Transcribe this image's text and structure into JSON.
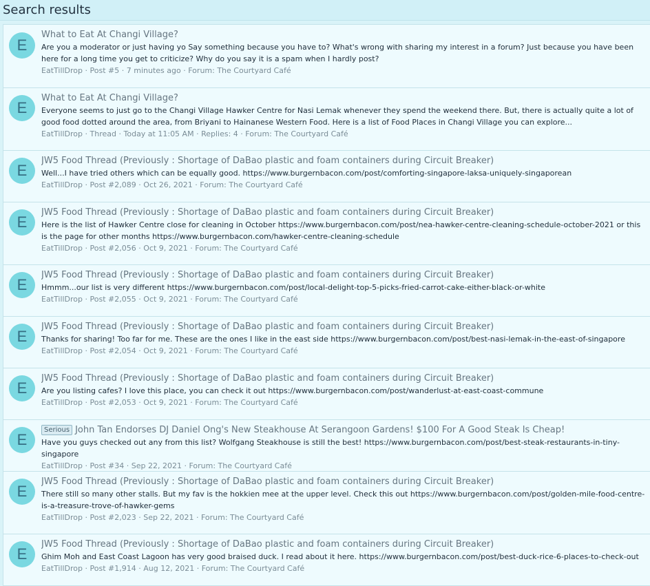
{
  "page": {
    "title": "Search results"
  },
  "results": [
    {
      "avatar_letter": "E",
      "badge": "",
      "title": "What to Eat At Changi Village?",
      "snippet": "Are you a moderator or just having yo Say something because you have to? What's wrong with sharing my interest in a forum? Just because you have been here for a long time you get to criticize? Why do you say it is a spam when I hardly post?",
      "meta": {
        "author": "EatTillDrop",
        "type": "Post #5",
        "time": "7 minutes ago",
        "forum": "Forum: The Courtyard Café"
      }
    },
    {
      "avatar_letter": "E",
      "badge": "",
      "title": "What to Eat At Changi Village?",
      "snippet": "Everyone seems to just go to the Changi Village Hawker Centre for Nasi Lemak whenever they spend the weekend there. But, there is actually quite a lot of good food dotted around the area, from Briyani to Hainanese Western Food. Here is a list of Food Places in Changi Village you can explore...",
      "meta": {
        "author": "EatTillDrop",
        "type": "Thread",
        "time": "Today at 11:05 AM",
        "replies": "Replies: 4",
        "forum": "Forum: The Courtyard Café"
      }
    },
    {
      "avatar_letter": "E",
      "badge": "",
      "title": "JW5 Food Thread (Previously : Shortage of DaBao plastic and foam containers during Circuit Breaker)",
      "snippet": "Well...I have tried others which can be equally good. https://www.burgernbacon.com/post/comforting-singapore-laksa-uniquely-singaporean",
      "meta": {
        "author": "EatTillDrop",
        "type": "Post #2,089",
        "time": "Oct 26, 2021",
        "forum": "Forum: The Courtyard Café"
      }
    },
    {
      "avatar_letter": "E",
      "badge": "",
      "title": "JW5 Food Thread (Previously : Shortage of DaBao plastic and foam containers during Circuit Breaker)",
      "snippet": "Here is the list of Hawker Centre close for cleaning in October https://www.burgernbacon.com/post/nea-hawker-centre-cleaning-schedule-october-2021 or this is the page for other months https://www.burgernbacon.com/hawker-centre-cleaning-schedule",
      "meta": {
        "author": "EatTillDrop",
        "type": "Post #2,056",
        "time": "Oct 9, 2021",
        "forum": "Forum: The Courtyard Café"
      }
    },
    {
      "avatar_letter": "E",
      "badge": "",
      "title": "JW5 Food Thread (Previously : Shortage of DaBao plastic and foam containers during Circuit Breaker)",
      "snippet": "Hmmm...our list is very different https://www.burgernbacon.com/post/local-delight-top-5-picks-fried-carrot-cake-either-black-or-white",
      "meta": {
        "author": "EatTillDrop",
        "type": "Post #2,055",
        "time": "Oct 9, 2021",
        "forum": "Forum: The Courtyard Café"
      }
    },
    {
      "avatar_letter": "E",
      "badge": "",
      "title": "JW5 Food Thread (Previously : Shortage of DaBao plastic and foam containers during Circuit Breaker)",
      "snippet": "Thanks for sharing! Too far for me. These are the ones I like in the east side https://www.burgernbacon.com/post/best-nasi-lemak-in-the-east-of-singapore",
      "meta": {
        "author": "EatTillDrop",
        "type": "Post #2,054",
        "time": "Oct 9, 2021",
        "forum": "Forum: The Courtyard Café"
      }
    },
    {
      "avatar_letter": "E",
      "badge": "",
      "title": "JW5 Food Thread (Previously : Shortage of DaBao plastic and foam containers during Circuit Breaker)",
      "snippet": "Are you listing cafes? I love this place, you can check it out https://www.burgernbacon.com/post/wanderlust-at-east-coast-commune",
      "meta": {
        "author": "EatTillDrop",
        "type": "Post #2,053",
        "time": "Oct 9, 2021",
        "forum": "Forum: The Courtyard Café"
      }
    },
    {
      "avatar_letter": "E",
      "badge": "Serious",
      "title": "John Tan Endorses DJ Daniel Ong's New Steakhouse At Serangoon Gardens! $100 For A Good Steak Is Cheap!",
      "snippet": "Have you guys checked out any from this list? Wolfgang Steakhouse is still the best! https://www.burgernbacon.com/post/best-steak-restaurants-in-tiny-singapore",
      "meta": {
        "author": "EatTillDrop",
        "type": "Post #34",
        "time": "Sep 22, 2021",
        "forum": "Forum: The Courtyard Café"
      }
    },
    {
      "avatar_letter": "E",
      "badge": "",
      "title": "JW5 Food Thread (Previously : Shortage of DaBao plastic and foam containers during Circuit Breaker)",
      "snippet": "There still so many other stalls. But my fav is the hokkien mee at the upper level. Check this out https://www.burgernbacon.com/post/golden-mile-food-centre-is-a-treasure-trove-of-hawker-gems",
      "meta": {
        "author": "EatTillDrop",
        "type": "Post #2,023",
        "time": "Sep 22, 2021",
        "forum": "Forum: The Courtyard Café"
      }
    },
    {
      "avatar_letter": "E",
      "badge": "",
      "title": "JW5 Food Thread (Previously : Shortage of DaBao plastic and foam containers during Circuit Breaker)",
      "snippet": "Ghim Moh and East Coast Lagoon has very good braised duck. I read about it here. https://www.burgernbacon.com/post/best-duck-rice-6-places-to-check-out",
      "meta": {
        "author": "EatTillDrop",
        "type": "Post #1,914",
        "time": "Aug 12, 2021",
        "forum": "Forum: The Courtyard Café"
      }
    }
  ]
}
